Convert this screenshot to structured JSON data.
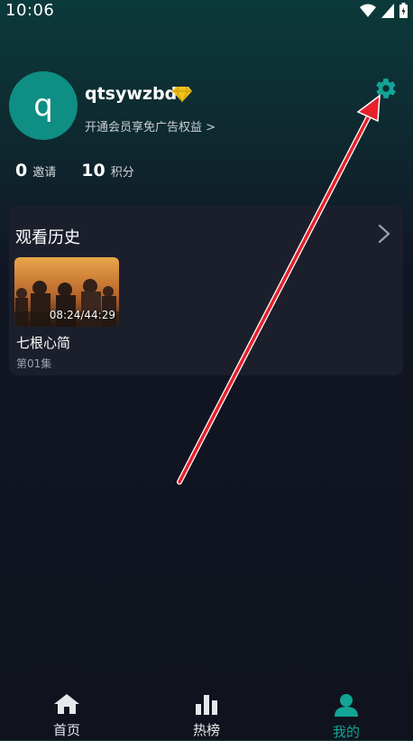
{
  "status_bar": {
    "time": "10:06"
  },
  "profile": {
    "avatar_letter": "q",
    "username": "qtsywzbd",
    "vip_link": "开通会员享免广告权益 >"
  },
  "stats": [
    {
      "value": "0",
      "label": "邀请"
    },
    {
      "value": "10",
      "label": "积分"
    }
  ],
  "history": {
    "title": "观看历史",
    "items": [
      {
        "progress": "08:24/44:29",
        "title": "七根心简",
        "episode": "第01集"
      }
    ]
  },
  "tabs": [
    {
      "label": "首页",
      "icon": "home-icon",
      "active": false
    },
    {
      "label": "热榜",
      "icon": "chart-icon",
      "active": false
    },
    {
      "label": "我的",
      "icon": "user-icon",
      "active": true
    }
  ],
  "colors": {
    "accent": "#0f8e83",
    "vip": "#f2c21b",
    "annotation_arrow": "#e8202a"
  }
}
